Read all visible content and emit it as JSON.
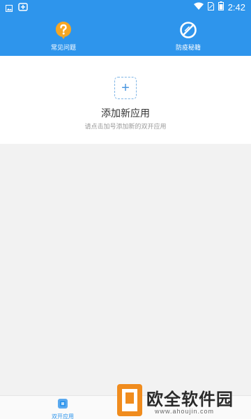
{
  "status_bar": {
    "time": "2:42",
    "icons": [
      "image-icon",
      "notification-app-icon",
      "wifi-icon",
      "sim-icon",
      "battery-icon"
    ]
  },
  "header": {
    "tools": [
      {
        "label": "常见问题",
        "icon": "question-icon"
      },
      {
        "label": "防疫秘籍",
        "icon": "no-symbol-icon"
      }
    ]
  },
  "main": {
    "add_icon": "+",
    "title": "添加新应用",
    "subtitle": "请点击加号添加新的双开应用"
  },
  "bottom_nav": {
    "items": [
      {
        "label": "双开应用",
        "icon": "dual-app-icon",
        "active": true
      }
    ]
  },
  "watermark": {
    "text": "欧全软件园",
    "url": "www.ahoujin.com"
  },
  "colors": {
    "primary": "#2e95ec",
    "faq_icon": "#f5a623",
    "background": "#f2f2f2",
    "watermark_orange": "#f08c1e"
  }
}
